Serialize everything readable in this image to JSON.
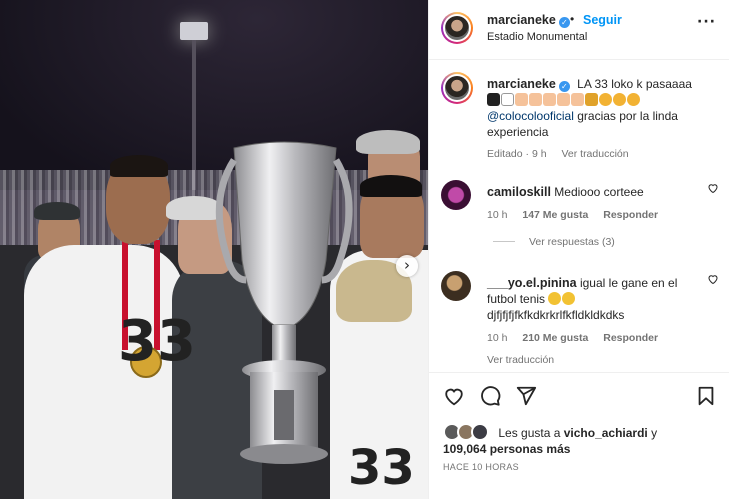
{
  "post": {
    "username": "marcianeke",
    "location": "Estadio Monumental",
    "follow_label": "Seguir",
    "dot": "•",
    "more": "···"
  },
  "caption": {
    "username": "marcianeke",
    "text_line1": "LA 33 loko k pasaaaa",
    "mention": "@colocolooficial",
    "text_line2": "gracias por la linda experiencia",
    "edited": "Editado · 9 h",
    "translate": "Ver traducción"
  },
  "comments": [
    {
      "username": "camiloskill",
      "text": "Mediooo corteee",
      "time": "10 h",
      "likes": "147 Me gusta",
      "reply": "Responder",
      "avatar_color": "#6b1f5c"
    },
    {
      "username": "___yo.el.pinina",
      "text_line1": "igual le gane en el futbol tenis",
      "text_line2": "djfjfjfjfkfkdkrkrlfkfldkldkdks",
      "time": "10 h",
      "likes": "210 Me gusta",
      "reply": "Responder",
      "translate": "Ver traducción",
      "avatar_color": "#4a3a2a"
    }
  ],
  "view_replies": "Ver respuestas (3)",
  "actions": {
    "like": "heart-icon",
    "comment": "comment-icon",
    "share": "share-icon",
    "save": "bookmark-icon"
  },
  "likes": {
    "prefix": "Les gusta a",
    "user": "vicho_achiardi",
    "conjunction": "y",
    "count": "109,064 personas más"
  },
  "timestamp": "HACE 10 HORAS",
  "photo": {
    "carousel_next": "›"
  },
  "colors": {
    "accent": "#0095f6",
    "verified": "#3897f0",
    "muted": "#737373",
    "mention": "#00376b"
  }
}
